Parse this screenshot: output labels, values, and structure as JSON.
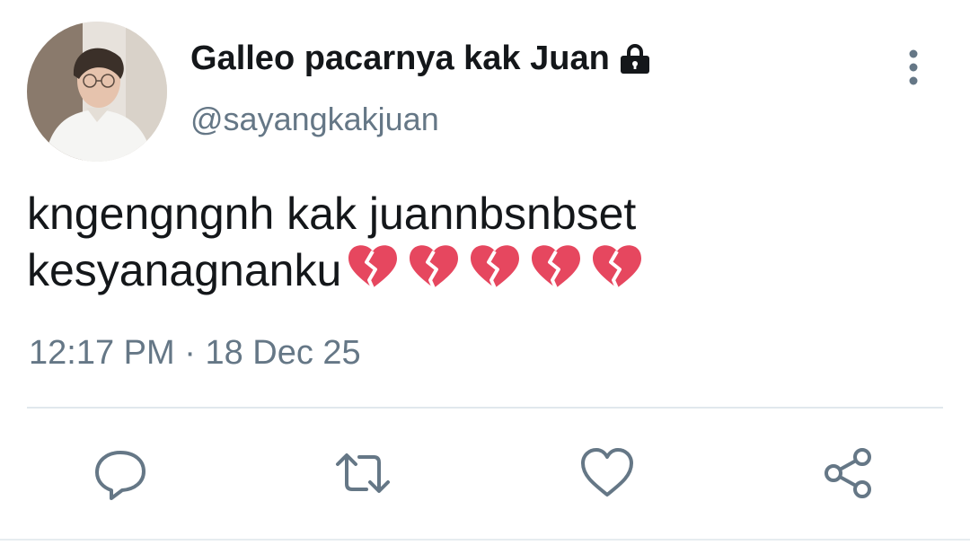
{
  "tweet": {
    "author": {
      "display_name": "Galleo pacarnya kak Juan",
      "handle": "@sayangkakjuan",
      "protected_icon": "lock-icon"
    },
    "text_lines": [
      "kngengngnh kak juannbsnbset",
      "kesyanagnanku"
    ],
    "emoji": [
      "broken-heart",
      "broken-heart",
      "broken-heart",
      "broken-heart",
      "broken-heart"
    ],
    "time": "12:17 PM",
    "separator": "·",
    "date": "18 Dec 25"
  },
  "actions": {
    "icons": [
      "reply-icon",
      "retweet-icon",
      "like-icon",
      "share-icon"
    ]
  },
  "colors": {
    "text": "#14171a",
    "secondary_text": "#657786",
    "icon": "#657786",
    "divider": "#e1e8ed",
    "heart": "#e6475f"
  }
}
